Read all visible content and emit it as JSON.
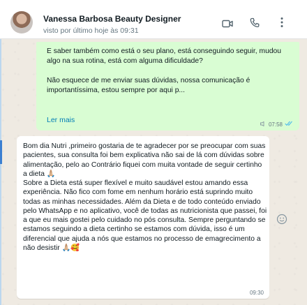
{
  "header": {
    "contact_name": "Vanessa Barbosa Beauty Designer",
    "status": "visto por último hoje às 09:31",
    "icons": [
      "video-icon",
      "phone-icon",
      "more-vertical-icon"
    ]
  },
  "messages": {
    "outgoing": {
      "text": "E saber também como está o seu plano, está conseguindo seguir, mudou algo na sua rotina, está com alguma dificuldade?\n\nNão esquece de me enviar suas dúvidas, nossa comunicação é importantíssima, estou sempre por aqui p...",
      "read_more": "Ler mais",
      "time": "07:58"
    },
    "incoming": {
      "text": "Bom dia Nutri ,primeiro gostaria de te agradecer por se preocupar com suas pacientes, sua consulta foi bem explicativa não sai de lá com dúvidas sobre alimentação, pelo ao Contrário fiquei com muita vontade de seguir certinho a dieta 🙏🏼\nSobre a Dieta está super flexível e muito saudável estou amando essa experiência. Não fico com fome em nenhum horário está suprindo muito todas as minhas necessidades. Além da Dieta e de todo conteúdo enviado pelo WhatsApp e no aplicativo, você de todas as nutricionista que passei, foi a que eu mais gostei pelo cuidado no pós consulta. Sempre perguntando se estamos seguindo a dieta certinho se estamos com dúvida, isso é um diferencial que ajuda a nós que estamos no processo de emagrecimento a não desistir 🙏🏼🥰",
      "time": "09:30"
    }
  },
  "colors": {
    "outgoing_bubble": "#d9fdd3",
    "incoming_bubble": "#ffffff",
    "chat_background": "#efeae2",
    "link": "#027eb5",
    "read_ticks": "#53bdeb"
  }
}
